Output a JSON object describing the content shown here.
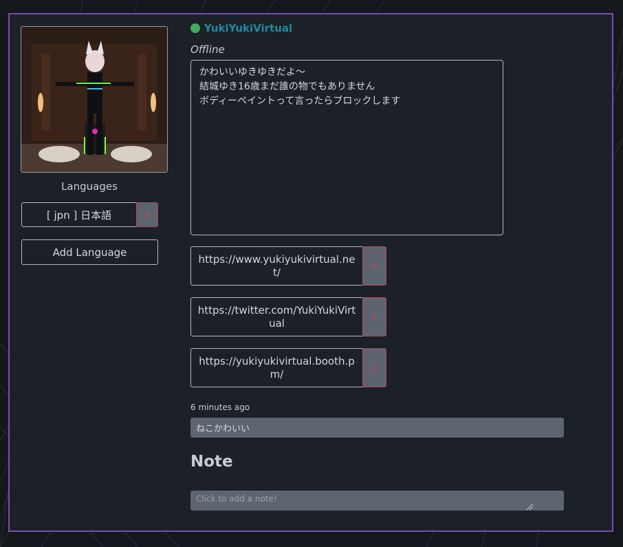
{
  "profile": {
    "username": "YukiYukiVirtual",
    "status": "Offline",
    "status_color": "#3fae5e",
    "accent_color": "#1f8aa3",
    "bio_lines": [
      "かわいいゆきゆきだよ～",
      "結城ゆき16歳まだ誰の物でもありません",
      "ボディーペイントって言ったらブロックします"
    ]
  },
  "languages": {
    "label": "Languages",
    "items": [
      {
        "text": "[ jpn ] 日本語",
        "remove": "×"
      }
    ],
    "add_label": "Add Language"
  },
  "links": [
    {
      "url": "https://www.yukiyukivirtual.net/",
      "remove": "×"
    },
    {
      "url": "https://twitter.com/YukiYukiVirtual",
      "remove": "×"
    },
    {
      "url": "https://yukiyukivirtual.booth.pm/",
      "remove": "×"
    }
  ],
  "status_message": {
    "timestamp": "6 minutes ago",
    "text": "ねこかわいい"
  },
  "note": {
    "heading": "Note",
    "placeholder": "Click to add a note!"
  },
  "colors": {
    "panel_border": "#7b4bb8",
    "remove_button": "#5d6470",
    "remove_x": "#c24a52"
  }
}
